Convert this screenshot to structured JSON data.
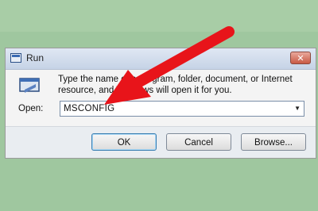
{
  "dialog": {
    "title": "Run",
    "close_glyph": "✕",
    "description": "Type the name of a program, folder, document, or Internet resource, and Windows will open it for you.",
    "open_label": "Open:",
    "open_value": "MSCONFIG",
    "dropdown_glyph": "▼",
    "buttons": {
      "ok": "OK",
      "cancel": "Cancel",
      "browse": "Browse..."
    }
  },
  "overlay": {
    "arrow_color": "#e8141a",
    "arrow_icon": "red-arrow-annotation"
  },
  "colors": {
    "background": "#9fc79f",
    "titlebar": "#c6d3e6",
    "close_button": "#c85a45"
  },
  "icons": [
    "run-program-icon",
    "run-window-icon",
    "close-icon",
    "chevron-down-icon"
  ]
}
